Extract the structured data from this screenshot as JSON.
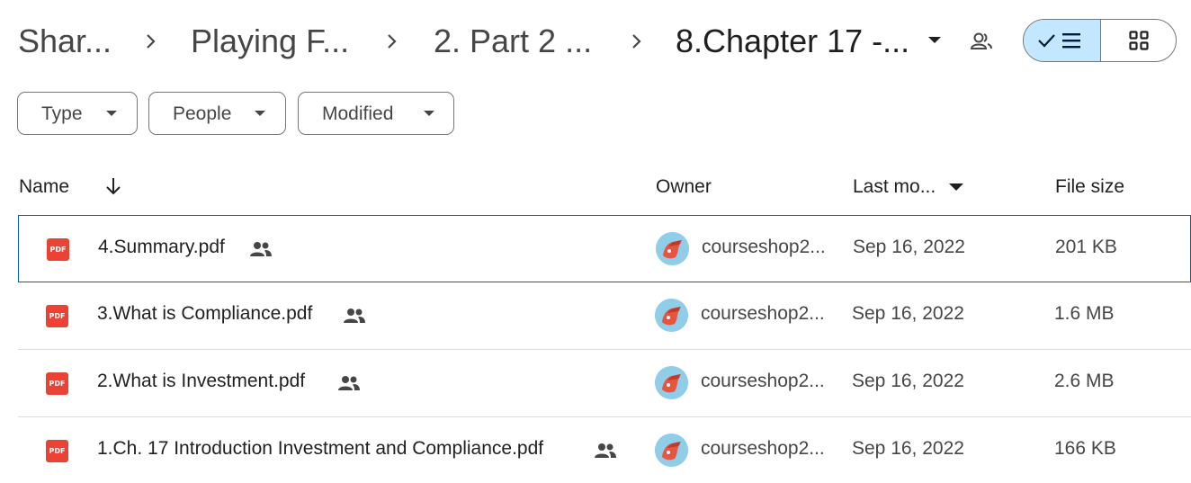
{
  "breadcrumb": {
    "items": [
      "Shar...",
      "Playing F...",
      "2. Part 2 ...",
      "8.Chapter 17 -..."
    ]
  },
  "view_toggle": {
    "list_selected": true
  },
  "filters": [
    {
      "label": "Type"
    },
    {
      "label": "People"
    },
    {
      "label": "Modified"
    }
  ],
  "table": {
    "headers": {
      "name": "Name",
      "owner": "Owner",
      "modified": "Last mo...",
      "size": "File size"
    },
    "rows": [
      {
        "name": "4.Summary.pdf",
        "owner": "courseshop2...",
        "modified": "Sep 16, 2022",
        "size": "201 KB"
      },
      {
        "name": "3.What is Compliance.pdf",
        "owner": "courseshop2...",
        "modified": "Sep 16, 2022",
        "size": "1.6 MB"
      },
      {
        "name": "2.What is Investment.pdf",
        "owner": "courseshop2...",
        "modified": "Sep 16, 2022",
        "size": "2.6 MB"
      },
      {
        "name": "1.Ch. 17 Introduction Investment and Compliance.pdf",
        "owner": "courseshop2...",
        "modified": "Sep 16, 2022",
        "size": "166 KB"
      }
    ]
  },
  "file_icon_label": "PDF",
  "colors": {
    "accent": "#0b57d0",
    "selected_toggle": "#c2e7ff",
    "pdf": "#ea4335"
  }
}
